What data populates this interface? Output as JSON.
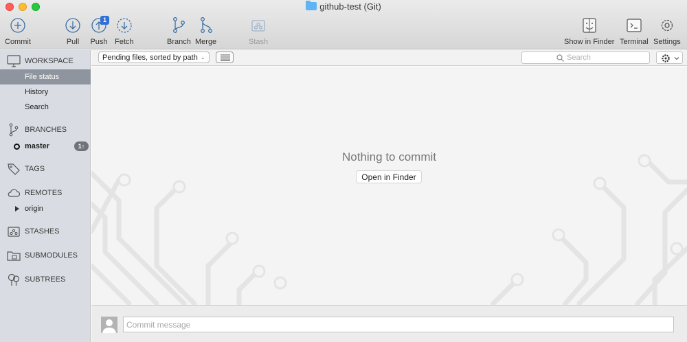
{
  "window": {
    "title": "github-test (Git)"
  },
  "toolbar": {
    "commit": "Commit",
    "pull": "Pull",
    "push": "Push",
    "push_badge": "1",
    "fetch": "Fetch",
    "branch": "Branch",
    "merge": "Merge",
    "stash": "Stash",
    "show_in_finder": "Show in Finder",
    "terminal": "Terminal",
    "settings": "Settings"
  },
  "sidebar": {
    "workspace": {
      "label": "WORKSPACE",
      "items": [
        "File status",
        "History",
        "Search"
      ],
      "selected": "File status"
    },
    "branches": {
      "label": "BRANCHES",
      "items": [
        {
          "name": "master",
          "badge": "1↑",
          "current": true
        }
      ]
    },
    "tags": {
      "label": "TAGS"
    },
    "remotes": {
      "label": "REMOTES",
      "items": [
        "origin"
      ]
    },
    "stashes": {
      "label": "STASHES"
    },
    "submodules": {
      "label": "SUBMODULES"
    },
    "subtrees": {
      "label": "SUBTREES"
    }
  },
  "filterbar": {
    "sort_label": "Pending files, sorted by path",
    "search_placeholder": "Search"
  },
  "main": {
    "empty_title": "Nothing to commit",
    "open_finder_label": "Open in Finder"
  },
  "commit": {
    "placeholder": "Commit message"
  },
  "colors": {
    "selected_row": "#8f959e",
    "accent": "#2f6fd6",
    "sidebar_bg": "#d9dde3"
  },
  "icons": [
    "commit-icon",
    "pull-icon",
    "push-icon",
    "fetch-icon",
    "branch-icon",
    "merge-icon",
    "stash-icon",
    "finder-icon",
    "terminal-icon",
    "settings-icon",
    "search-icon",
    "gear-icon",
    "list-icon",
    "monitor-icon",
    "tag-icon",
    "cloud-icon",
    "folder-icon",
    "tree-icon"
  ]
}
